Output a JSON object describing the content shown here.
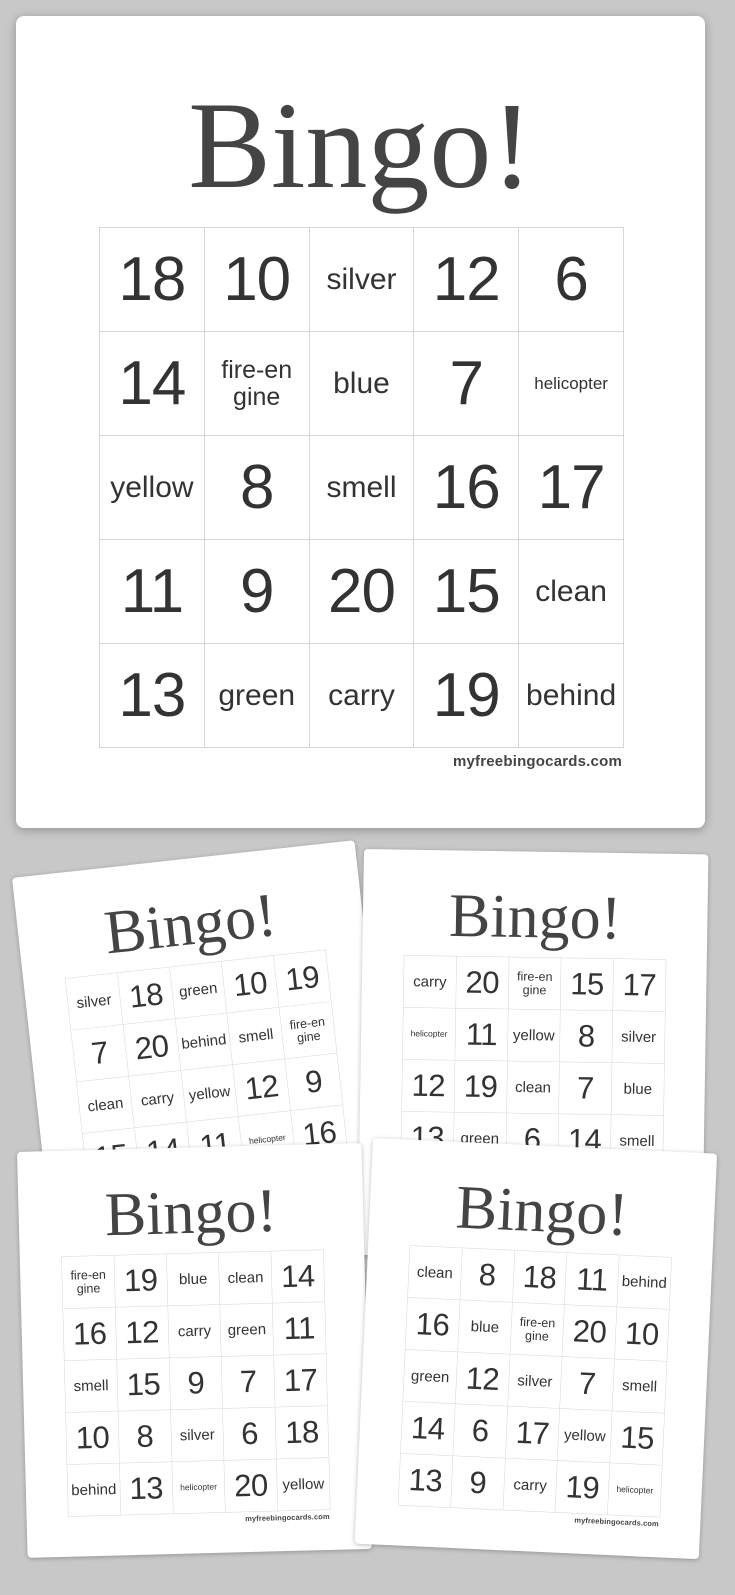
{
  "title": "Bingo!",
  "footer": "myfreebingocards.com",
  "colors": {
    "background": "#c8c8c8",
    "card": "#ffffff",
    "text": "#333333",
    "grid_line": "#d6d6d6"
  },
  "cards": [
    {
      "name": "main-card",
      "cells": [
        "18",
        "10",
        "silver",
        "12",
        "6",
        "14",
        "fire-engine",
        "blue",
        "7",
        "helicopter",
        "yellow",
        "8",
        "smell",
        "16",
        "17",
        "11",
        "9",
        "20",
        "15",
        "clean",
        "13",
        "green",
        "carry",
        "19",
        "behind"
      ]
    },
    {
      "name": "card-back-left",
      "cells": [
        "silver",
        "18",
        "green",
        "10",
        "19",
        "7",
        "20",
        "behind",
        "smell",
        "fire-engine",
        "clean",
        "carry",
        "yellow",
        "12",
        "9",
        "15",
        "14",
        "11",
        "helicopter",
        "16"
      ]
    },
    {
      "name": "card-back-right",
      "cells": [
        "carry",
        "20",
        "fire-engine",
        "15",
        "17",
        "helicopter",
        "11",
        "yellow",
        "8",
        "silver",
        "12",
        "19",
        "clean",
        "7",
        "blue",
        "13",
        "green",
        "6",
        "14",
        "smell"
      ]
    },
    {
      "name": "card-front-left",
      "cells": [
        "fire-engine",
        "19",
        "blue",
        "clean",
        "14",
        "16",
        "12",
        "carry",
        "green",
        "11",
        "smell",
        "15",
        "9",
        "7",
        "17",
        "10",
        "8",
        "silver",
        "6",
        "18",
        "behind",
        "13",
        "helicopter",
        "20",
        "yellow"
      ]
    },
    {
      "name": "card-front-right",
      "cells": [
        "clean",
        "8",
        "18",
        "11",
        "behind",
        "16",
        "blue",
        "fire-engine",
        "20",
        "10",
        "green",
        "12",
        "silver",
        "7",
        "smell",
        "14",
        "6",
        "17",
        "yellow",
        "15",
        "13",
        "9",
        "carry",
        "19",
        "helicopter"
      ]
    }
  ]
}
